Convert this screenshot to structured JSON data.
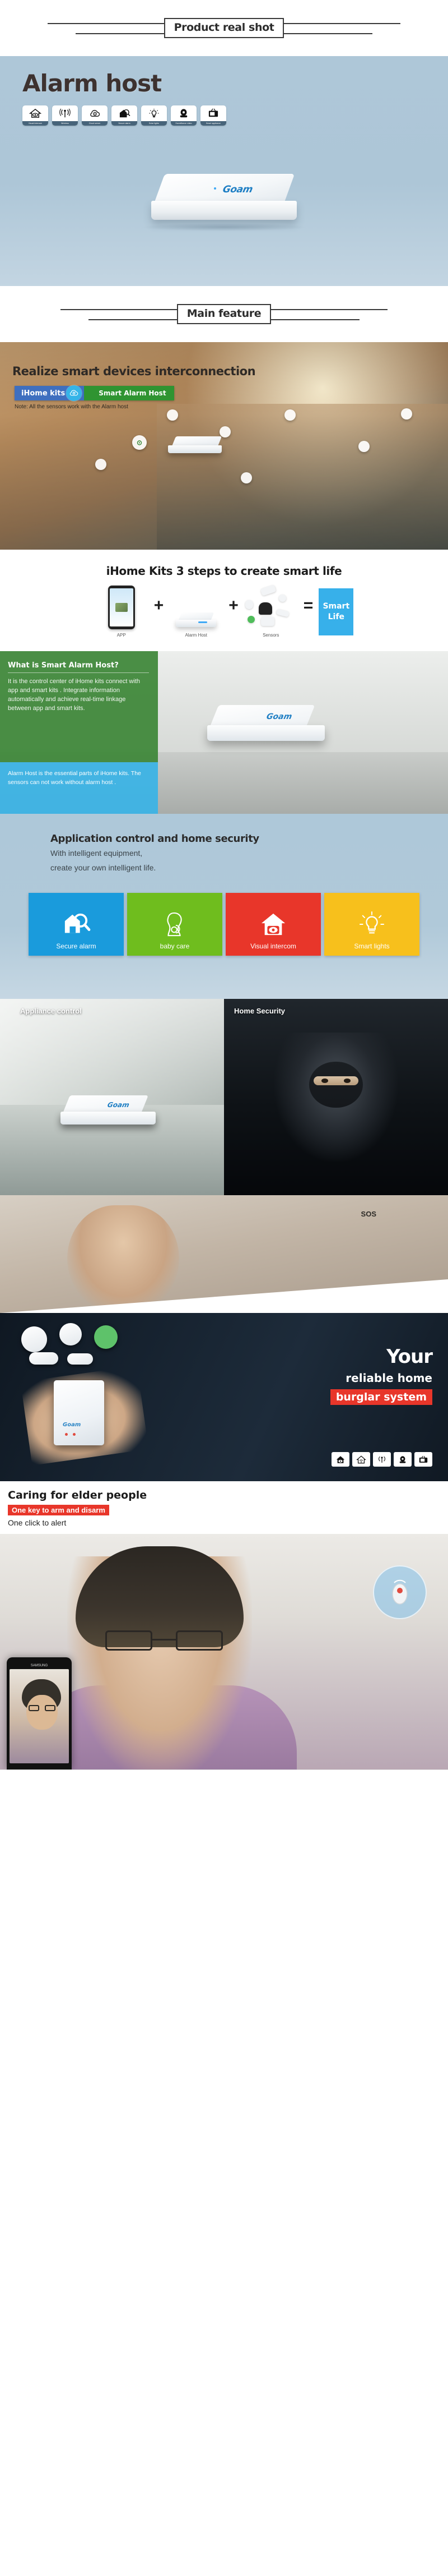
{
  "sections": {
    "head1": {
      "label": "Product real shot"
    },
    "head2": {
      "label": "Main feature"
    }
  },
  "alarm_banner": {
    "title": "Alarm host",
    "icons": [
      {
        "name": "visual-intercom-icon",
        "caption": "Visual intercom"
      },
      {
        "name": "wireless-icon",
        "caption": "Wireless"
      },
      {
        "name": "cloud-server-icon",
        "caption": "Cloud server"
      },
      {
        "name": "secure-alarm-icon",
        "caption": "Secure alarm"
      },
      {
        "name": "solar-lights-icon",
        "caption": "Solar lights"
      },
      {
        "name": "surveillance-video-icon",
        "caption": "Surveillance video"
      },
      {
        "name": "smart-appliance-icon",
        "caption": "Smart appliance"
      }
    ],
    "device_logo": "Goam"
  },
  "interconnect": {
    "title": "Realize smart devices interconnection",
    "badge_left": "iHome kits",
    "badge_right": "Smart Alarm Host",
    "note": "Note: All the sensors work with the Alarm host"
  },
  "steps": {
    "title": "iHome Kits 3 steps to create smart life",
    "items": [
      {
        "label": "APP"
      },
      {
        "label": "Alarm Host"
      },
      {
        "label": "Sensors"
      }
    ],
    "plus": "+",
    "equals": "=",
    "result_line1": "Smart",
    "result_line2": "Life"
  },
  "info": {
    "green_title": "What is Smart Alarm Host?",
    "green_body": "It is the control center of iHome kits connect with app and smart kits . Integrate  information automatically and achieve real-time linkage between app and smart kits.",
    "blue_body": "Alarm Host is the essential parts of iHome kits. The sensors can not work without alarm host .",
    "device_logo": "Goam"
  },
  "appctl": {
    "title": "Application control and home security",
    "line1": "With intelligent equipment,",
    "line2": "create your own intelligent life.",
    "cards": [
      {
        "label": "Secure alarm",
        "color": "#1a9bdc",
        "icon": "house-search-icon"
      },
      {
        "label": "baby care",
        "color": "#6fbd1e",
        "icon": "baby-care-icon"
      },
      {
        "label": "Visual intercom",
        "color": "#e8362a",
        "icon": "house-eye-icon"
      },
      {
        "label": "Smart lights",
        "color": "#f7c01c",
        "icon": "lightbulb-icon"
      }
    ]
  },
  "duo": {
    "left_tag": "Appliance control",
    "right_tag": "Home Security",
    "device_logo": "Goam",
    "sos": "SOS"
  },
  "dark": {
    "line1": "Your",
    "line2": "reliable home",
    "line3": "burglar system",
    "device_logo": "Goam",
    "icons": [
      {
        "name": "house-eye-icon"
      },
      {
        "name": "house-wifi-icon"
      },
      {
        "name": "wireless-icon"
      },
      {
        "name": "surveillance-video-icon"
      },
      {
        "name": "smart-appliance-icon"
      }
    ]
  },
  "caring": {
    "title": "Caring for elder people",
    "highlight": "One key to arm and disarm",
    "subtitle": "One click to alert",
    "phone_brand": "SAMSUNG"
  },
  "colors": {
    "banner_blue": "#aec7d8",
    "accent_red": "#e8362a",
    "accent_blue": "#37b0ea",
    "accent_green": "#2f9431",
    "brand_blue": "#1f7fc4"
  }
}
